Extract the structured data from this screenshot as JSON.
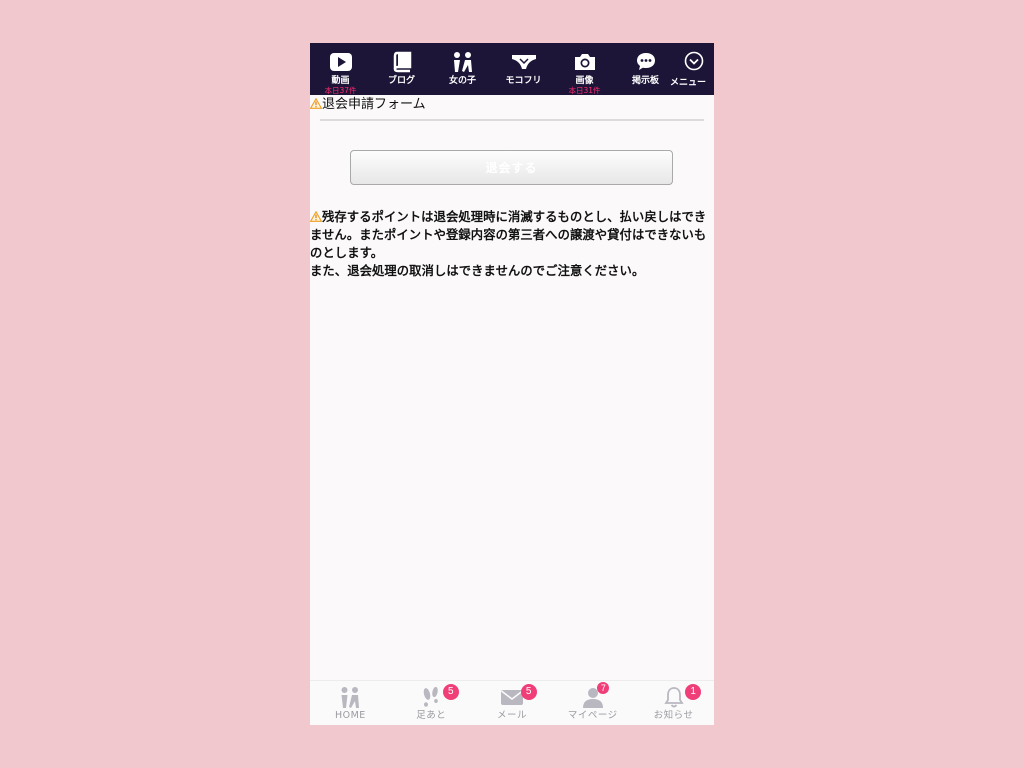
{
  "top_nav": {
    "items": [
      {
        "icon": "play-icon",
        "label": "動画",
        "sub": "本日37件"
      },
      {
        "icon": "book-icon",
        "label": "ブログ",
        "sub": ""
      },
      {
        "icon": "girls-icon",
        "label": "女の子",
        "sub": ""
      },
      {
        "icon": "underwear-icon",
        "label": "モコフリ",
        "sub": ""
      },
      {
        "icon": "camera-icon",
        "label": "画像",
        "sub": "本日31件"
      },
      {
        "icon": "chat-bubble-icon",
        "label": "掲示板",
        "sub": ""
      },
      {
        "icon": "chevron-down-circle-icon",
        "label": "メニュー",
        "sub": ""
      }
    ]
  },
  "form": {
    "title": "退会申請フォーム",
    "button_label": "退会する"
  },
  "notice": {
    "line1": "残存するポイントは退会処理時に消滅するものとし、払い戻しはできません。またポイントや登録内容の第三者への譲渡や貸付はできないものとします。",
    "line2": "また、退会処理の取消しはできませんのでご注意ください。"
  },
  "bottom_nav": {
    "items": [
      {
        "icon": "home-girls-icon",
        "label": "HOME",
        "badge": ""
      },
      {
        "icon": "footprints-icon",
        "label": "足あと",
        "badge": "5"
      },
      {
        "icon": "mail-icon",
        "label": "メール",
        "badge": "5"
      },
      {
        "icon": "user-icon",
        "label": "マイページ",
        "badge": "7"
      },
      {
        "icon": "bell-icon",
        "label": "お知らせ",
        "badge": "1"
      }
    ]
  },
  "colors": {
    "background": "#f1c8cd",
    "nav_bg": "#1c1538",
    "accent_pink": "#ef3e78",
    "warning": "#f0a020"
  }
}
